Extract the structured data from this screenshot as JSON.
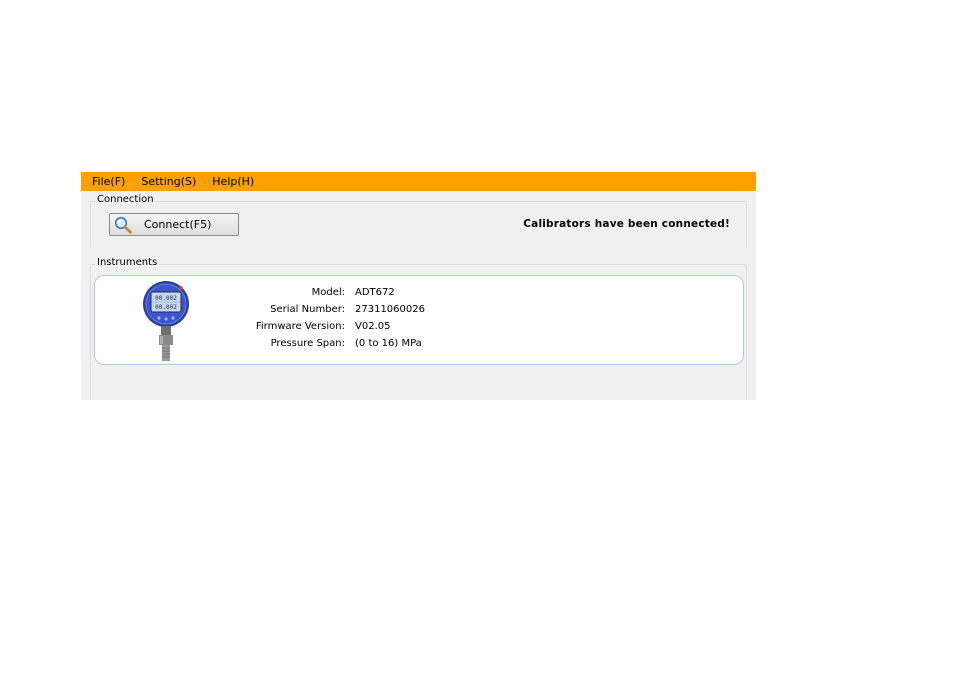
{
  "menu": {
    "file": "File(F)",
    "setting": "Setting(S)",
    "help": "Help(H)"
  },
  "connection": {
    "title": "Connection",
    "connect_label": "Connect(F5)",
    "status": "Calibrators have been connected!"
  },
  "instruments": {
    "title": "Instruments",
    "items": [
      {
        "rows": [
          {
            "key": "Model:",
            "value": "ADT672"
          },
          {
            "key": "Serial Number:",
            "value": "27311060026"
          },
          {
            "key": "Firmware Version:",
            "value": "V02.05"
          },
          {
            "key": "Pressure Span:",
            "value": "(0 to 16) MPa"
          }
        ],
        "device_display": [
          "00.002",
          "00.002"
        ]
      }
    ]
  },
  "colors": {
    "menubar": "#ff9f00",
    "card_border": "#aecbe6",
    "device_face": "#3d55c8"
  },
  "icons": {
    "connect": "magnifier-icon",
    "device": "pressure-gauge-icon"
  }
}
